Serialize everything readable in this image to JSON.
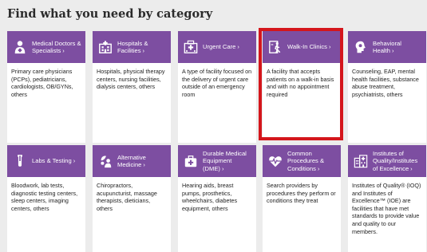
{
  "page_title": "Find what you need by category",
  "colors": {
    "header_purple": "#7d4ea1",
    "highlight_red": "#d4161c",
    "background": "#ececec"
  },
  "categories": [
    {
      "label": "Medical Doctors & Specialists",
      "chevron": "›",
      "icon": "doctor-icon",
      "description": "Primary care physicians (PCPs), pediatricians, cardiologists, OB/GYNs, others"
    },
    {
      "label": "Hospitals & Facilities",
      "chevron": "›",
      "icon": "hospital-icon",
      "description": "Hospitals, physical therapy centers, nursing facilities, dialysis centers, others"
    },
    {
      "label": "Urgent Care",
      "chevron": "›",
      "icon": "urgent-care-icon",
      "description": "A type of facility focused on the delivery of urgent care outside of an emergency room"
    },
    {
      "label": "Walk-In Clinics",
      "chevron": "›",
      "icon": "walk-in-clinic-icon",
      "highlighted": true,
      "description": "A facility that accepts patients on a walk-in basis and with no appointment required"
    },
    {
      "label": "Behavioral Health",
      "chevron": "›",
      "icon": "behavioral-health-icon",
      "description": "Counseling, EAP, mental health facilities, substance abuse treatment, psychiatrists, others"
    },
    {
      "label": "Labs & Testing",
      "chevron": "›",
      "icon": "test-tube-icon",
      "description": "Bloodwork, lab tests, diagnostic testing centers, sleep centers, imaging centers, others"
    },
    {
      "label": "Alternative Medicine",
      "chevron": "›",
      "icon": "alternative-medicine-icon",
      "description": "Chiropractors, acupuncturist, massage therapists, dieticians, others"
    },
    {
      "label": "Durable Medical Equipment (DME)",
      "chevron": "›",
      "icon": "medical-bag-icon",
      "description": "Hearing aids, breast pumps, prosthetics, wheelchairs, diabetes equipment, others"
    },
    {
      "label": "Common Procedures & Conditions",
      "chevron": "›",
      "icon": "heartbeat-icon",
      "description": "Search providers by procedures they perform or conditions they treat"
    },
    {
      "label": "Institutes of Quality/Institutes of Excellence",
      "chevron": "›",
      "icon": "institute-building-icon",
      "description": "Institutes of Quality® (IOQ) and Institutes of Excellence™ (IOE) are facilities that have met standards to provide value and quality to our members."
    }
  ]
}
